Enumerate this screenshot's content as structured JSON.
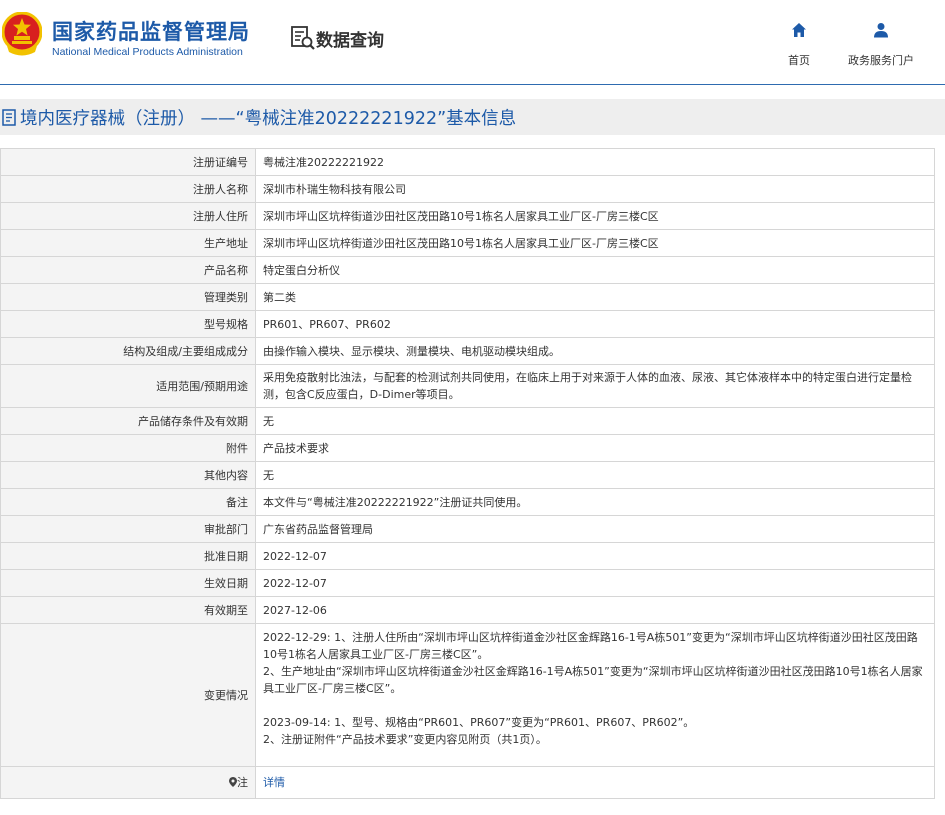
{
  "header": {
    "logo_cn": "国家药品监督管理局",
    "logo_en": "National Medical Products Administration",
    "data_query": "数据查询",
    "nav": [
      {
        "label": "首页",
        "icon": "home-icon"
      },
      {
        "label": "政务服务门户",
        "icon": "user-icon"
      }
    ]
  },
  "page_title": "境内医疗器械（注册） ——“粤械注准20222221922”基本信息",
  "fields": [
    {
      "label": "注册证编号",
      "value": "粤械注准20222221922"
    },
    {
      "label": "注册人名称",
      "value": "深圳市朴瑞生物科技有限公司"
    },
    {
      "label": "注册人住所",
      "value": "深圳市坪山区坑梓街道沙田社区茂田路10号1栋名人居家具工业厂区-厂房三楼C区"
    },
    {
      "label": "生产地址",
      "value": "深圳市坪山区坑梓街道沙田社区茂田路10号1栋名人居家具工业厂区-厂房三楼C区"
    },
    {
      "label": "产品名称",
      "value": "特定蛋白分析仪"
    },
    {
      "label": "管理类别",
      "value": "第二类"
    },
    {
      "label": "型号规格",
      "value": "PR601、PR607、PR602"
    },
    {
      "label": "结构及组成/主要组成成分",
      "value": "由操作输入模块、显示模块、测量模块、电机驱动模块组成。"
    },
    {
      "label": "适用范围/预期用途",
      "value": "采用免疫散射比浊法，与配套的检测试剂共同使用，在临床上用于对来源于人体的血液、尿液、其它体液样本中的特定蛋白进行定量检测，包含C反应蛋白，D-Dimer等项目。"
    },
    {
      "label": "产品储存条件及有效期",
      "value": "无"
    },
    {
      "label": "附件",
      "value": "产品技术要求"
    },
    {
      "label": "其他内容",
      "value": "无"
    },
    {
      "label": "备注",
      "value": "本文件与“粤械注准20222221922”注册证共同使用。"
    },
    {
      "label": "审批部门",
      "value": "广东省药品监督管理局"
    },
    {
      "label": "批准日期",
      "value": "2022-12-07"
    },
    {
      "label": "生效日期",
      "value": "2022-12-07"
    },
    {
      "label": "有效期至",
      "value": "2027-12-06"
    }
  ],
  "changes": {
    "label": "变更情况",
    "lines": [
      "2022-12-29: 1、注册人住所由“深圳市坪山区坑梓街道金沙社区金辉路16-1号A栋501”变更为“深圳市坪山区坑梓街道沙田社区茂田路10号1栋名人居家具工业厂区-厂房三楼C区”。",
      "2、生产地址由“深圳市坪山区坑梓街道金沙社区金辉路16-1号A栋501”变更为“深圳市坪山区坑梓街道沙田社区茂田路10号1栋名人居家具工业厂区-厂房三楼C区”。",
      "",
      "2023-09-14: 1、型号、规格由“PR601、PR607”变更为“PR601、PR607、PR602”。",
      "2、注册证附件“产品技术要求”变更内容见附页（共1页）。"
    ]
  },
  "note": {
    "label": "注",
    "icon": "location-pin-icon",
    "link": "详情"
  },
  "colors": {
    "brand_blue": "#1d5aa8",
    "label_bg": "#f4f4f4",
    "title_bar_bg": "#eeeeee",
    "emblem_red": "#d8201f",
    "emblem_gold": "#f2c200"
  }
}
